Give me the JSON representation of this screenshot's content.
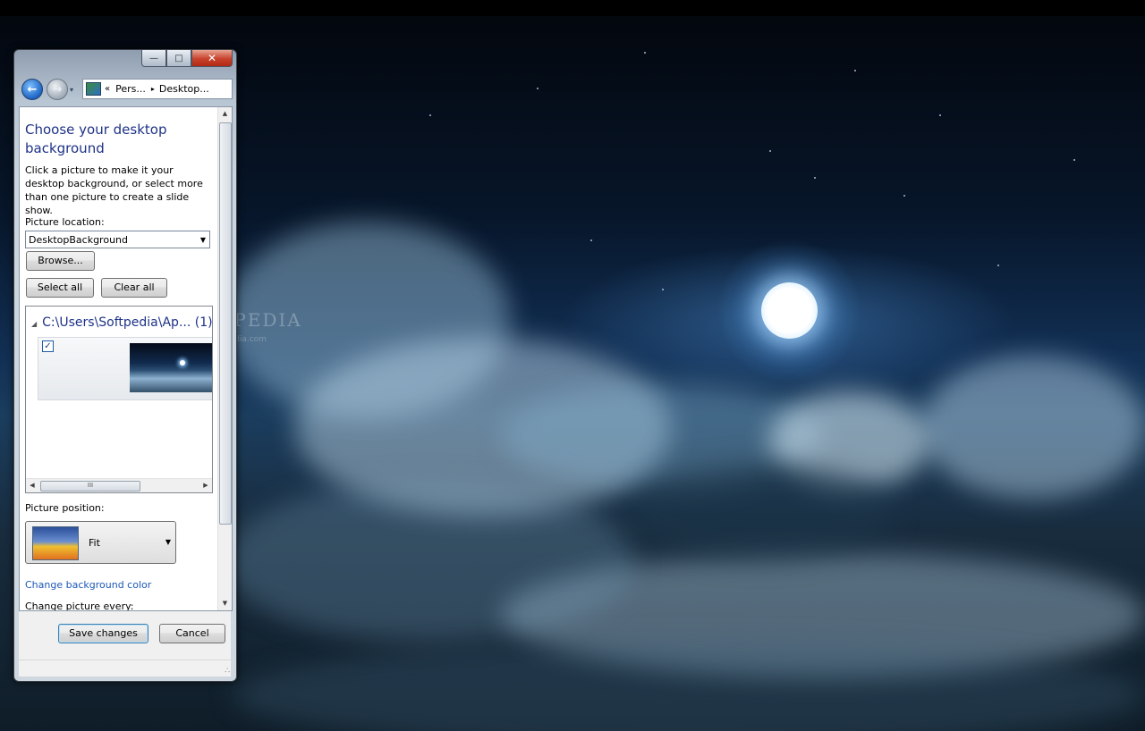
{
  "watermark": {
    "brand": "SOFTPEDIA",
    "url": "www.softpedia.com"
  },
  "window": {
    "caption_buttons": {
      "minimize": "—",
      "maximize": "□",
      "close": "✕"
    },
    "navigation": {
      "back_icon": "back-arrow-icon",
      "forward_icon": "forward-arrow-icon",
      "breadcrumb": [
        "Pers...",
        "Desktop..."
      ],
      "overflow": "«",
      "separator": "▸"
    },
    "content": {
      "title": "Choose your desktop background",
      "description": "Click a picture to make it your desktop background, or select more than one picture to create a slide show.",
      "picture_location_label": "Picture location:",
      "picture_location_value": "DesktopBackground",
      "browse_label": "Browse...",
      "select_all_label": "Select all",
      "clear_all_label": "Clear all",
      "picture_group": {
        "path": "C:\\Users\\Softpedia\\Ap...",
        "count": "(1)",
        "items": [
          {
            "checked": true,
            "thumbnail": "night-clouds-moon-wallpaper"
          }
        ]
      },
      "hscroll_grip": "III",
      "picture_position_label": "Picture position:",
      "picture_position_value": "Fit",
      "change_background_color_label": "Change background color",
      "change_picture_every_label": "Change picture every:"
    },
    "footer": {
      "save_label": "Save changes",
      "cancel_label": "Cancel"
    }
  },
  "colors": {
    "link": "#1e58b8",
    "heading": "#1e3287",
    "close_button": "#c8412b"
  }
}
